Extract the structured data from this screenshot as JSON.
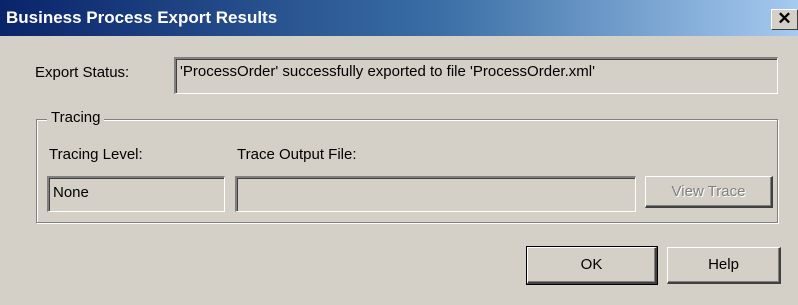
{
  "window": {
    "title": "Business Process Export Results",
    "close_glyph": "✕"
  },
  "export_status": {
    "label": "Export Status:",
    "value": "'ProcessOrder' successfully exported to file 'ProcessOrder.xml'"
  },
  "tracing": {
    "group_label": "Tracing",
    "level_label": "Tracing Level:",
    "level_value": "None",
    "output_label": "Trace Output File:",
    "output_value": "",
    "view_trace_label": "View Trace"
  },
  "buttons": {
    "ok_label": "OK",
    "help_label": "Help"
  }
}
